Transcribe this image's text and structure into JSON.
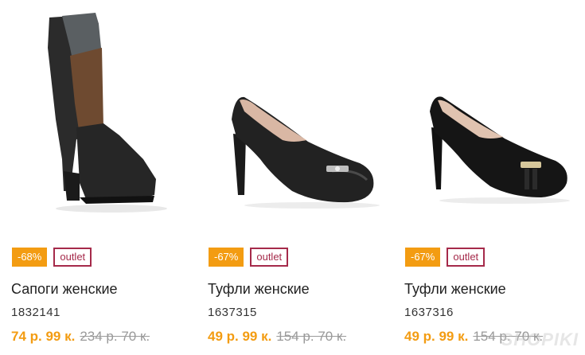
{
  "products": [
    {
      "image_icon": "tall-boot-image",
      "discount": "-68%",
      "tag": "outlet",
      "name": "Сапоги женские",
      "sku": "1832141",
      "price_now": "74 р. 99 к.",
      "price_old": "234 р. 70 к."
    },
    {
      "image_icon": "leather-pump-image",
      "discount": "-67%",
      "tag": "outlet",
      "name": "Туфли женские",
      "sku": "1637315",
      "price_now": "49 р. 99 к.",
      "price_old": "154 р. 70 к."
    },
    {
      "image_icon": "suede-pump-image",
      "discount": "-67%",
      "tag": "outlet",
      "name": "Туфли женские",
      "sku": "1637316",
      "price_now": "49 р. 99 к.",
      "price_old": "154 р. 70 к."
    }
  ],
  "colors": {
    "discount_bg": "#f39c12",
    "outlet_border": "#a52a4a",
    "price_now": "#f39c12",
    "price_old": "#9a9a9a"
  },
  "watermark": "SHOPIKI"
}
